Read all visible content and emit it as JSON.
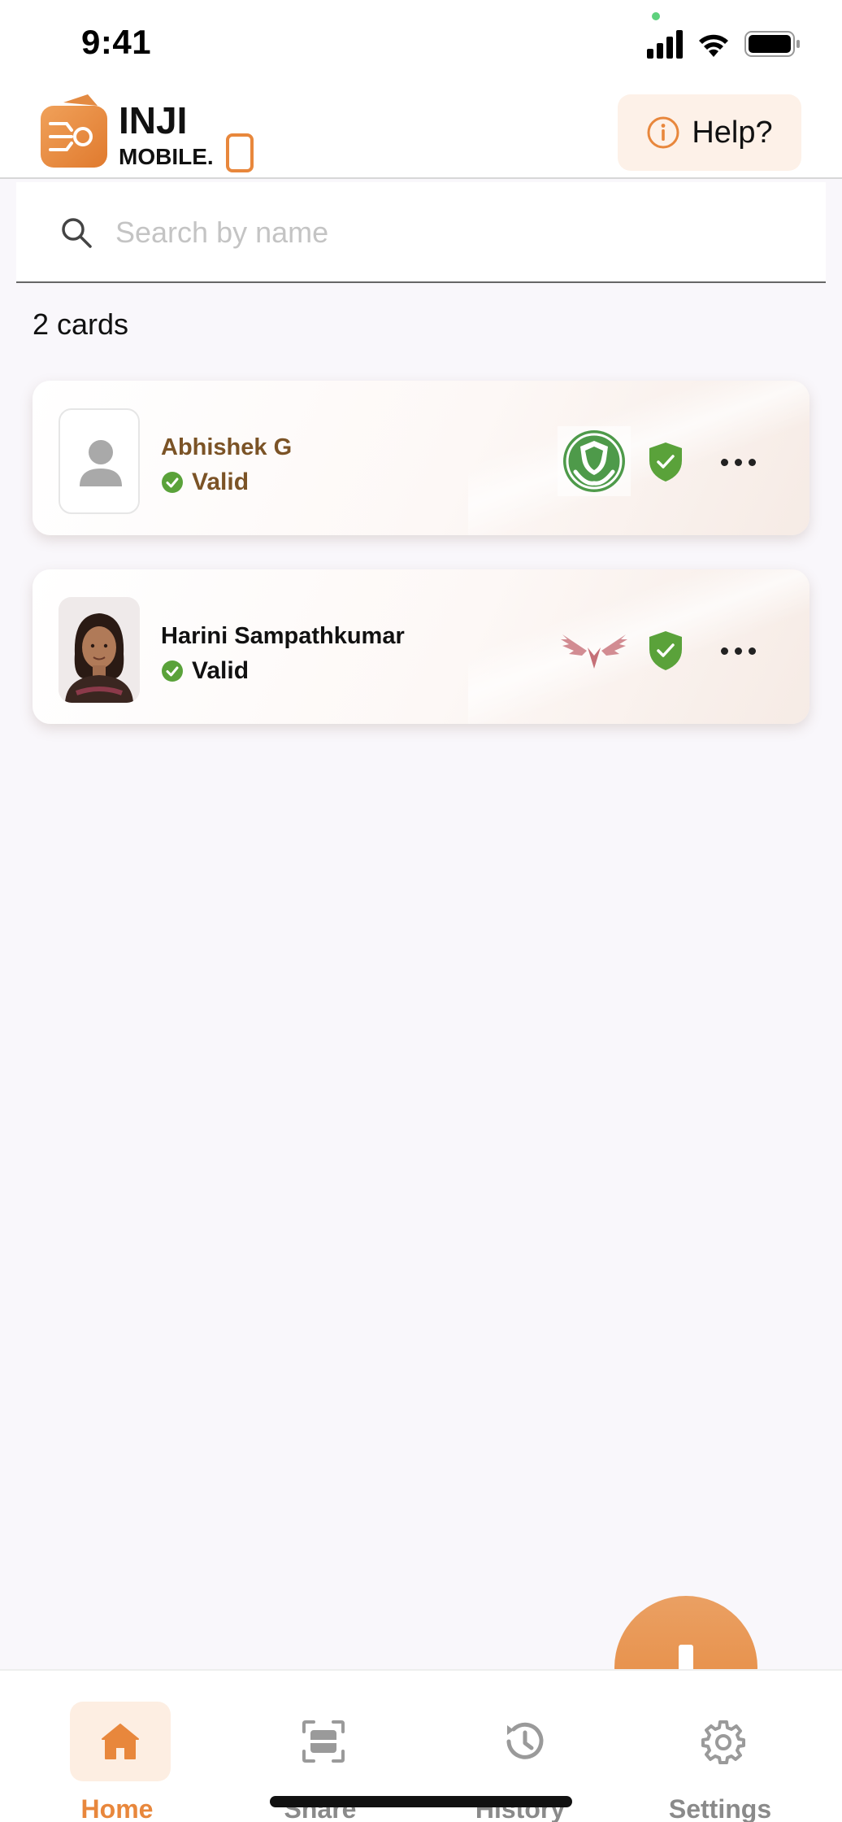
{
  "status_bar": {
    "time": "9:41"
  },
  "header": {
    "logo_text_top": "INJI",
    "logo_text_bottom": "MOBILE.",
    "help_label": "Help?"
  },
  "search": {
    "placeholder": "Search by name",
    "value": ""
  },
  "cards_count_label": "2 cards",
  "cards": [
    {
      "name": "Abhishek G",
      "status": "Valid",
      "name_color": "#7b5326",
      "issuer_icon": "green-shield-hands-icon"
    },
    {
      "name": "Harini Sampathkumar",
      "status": "Valid",
      "name_color": "#111111",
      "issuer_icon": "red-wings-icon"
    }
  ],
  "bottom_nav": {
    "items": [
      {
        "label": "Home",
        "icon": "home-icon",
        "active": true
      },
      {
        "label": "Share",
        "icon": "scan-qr-icon",
        "active": false
      },
      {
        "label": "History",
        "icon": "history-icon",
        "active": false
      },
      {
        "label": "Settings",
        "icon": "gear-icon",
        "active": false
      }
    ]
  },
  "colors": {
    "accent": "#e8873c",
    "valid_green": "#5aa23a",
    "background": "#f9f7fb"
  }
}
